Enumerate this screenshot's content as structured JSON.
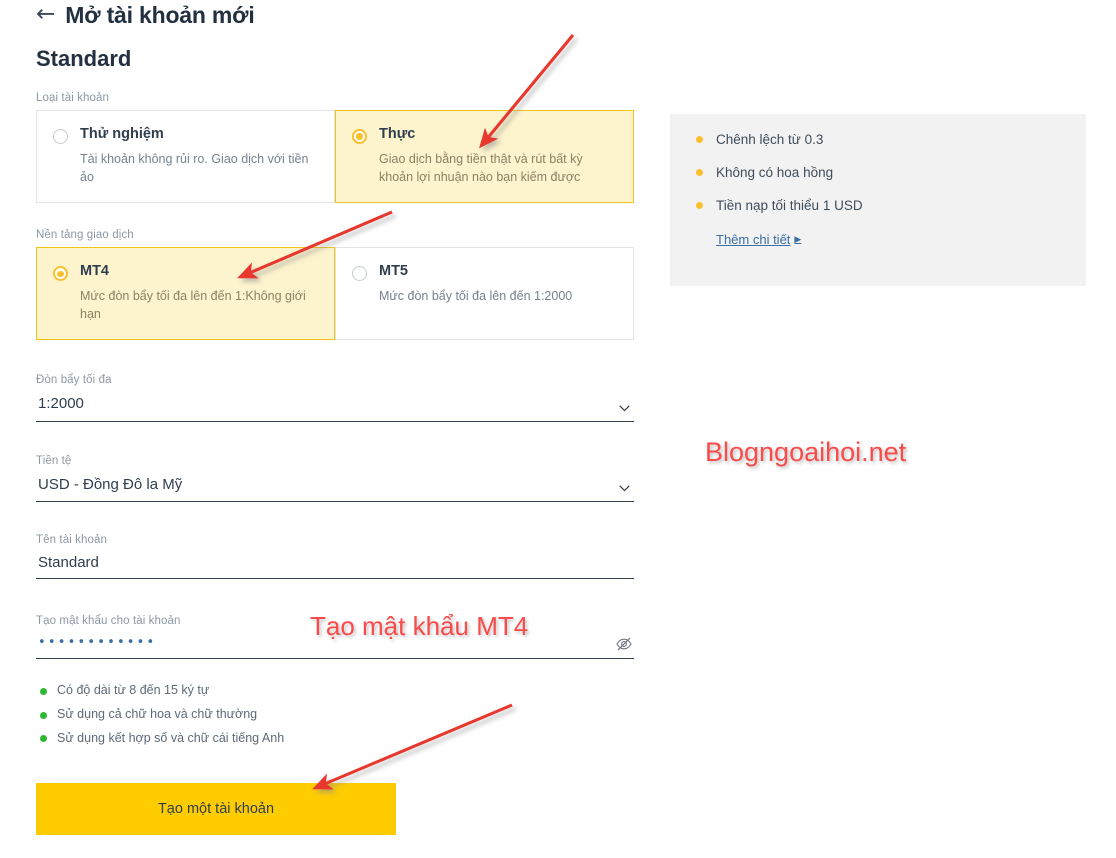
{
  "header": {
    "back_icon": "back-arrow-icon",
    "title": "Mở tài khoản mới",
    "subtitle": "Standard"
  },
  "form": {
    "account_type": {
      "label": "Loại tài khoản",
      "options": [
        {
          "title": "Thử nghiệm",
          "desc": "Tài khoản không rủi ro. Giao dịch với tiền ảo",
          "selected": false
        },
        {
          "title": "Thực",
          "desc": "Giao dịch bằng tiền thật và rút bất kỳ khoản lợi nhuận nào bạn kiếm được",
          "selected": true
        }
      ]
    },
    "platform": {
      "label": "Nền tảng giao dịch",
      "options": [
        {
          "title": "MT4",
          "desc": "Mức đòn bẩy tối đa lên đến 1:Không giới hạn",
          "selected": true
        },
        {
          "title": "MT5",
          "desc": "Mức đòn bẩy tối đa lên đến 1:2000",
          "selected": false
        }
      ]
    },
    "leverage": {
      "label": "Đòn bẩy tối đa",
      "value": "1:2000",
      "icon": "chevron-down-icon"
    },
    "currency": {
      "label": "Tiền tệ",
      "value": "USD - Đồng Đô la Mỹ",
      "icon": "chevron-down-icon"
    },
    "account_name": {
      "label": "Tên tài khoản",
      "value": "Standard"
    },
    "password": {
      "label": "Tạo mật khẩu cho tài khoản",
      "value": "••••••••••••",
      "toggle_icon": "eye-off-icon"
    },
    "requirements": [
      "Có độ dài từ 8 đến 15 ký tự",
      "Sử dụng cả chữ hoa và chữ thường",
      "Sử dụng kết hợp số và chữ cái tiếng Anh"
    ],
    "submit_label": "Tạo một tài khoản"
  },
  "info_panel": {
    "items": [
      "Chênh lệch từ 0.3",
      "Không có hoa hồng",
      "Tiền nạp tối thiểu 1 USD"
    ],
    "more_link": "Thêm chi tiết",
    "more_link_arrow": "▶"
  },
  "annotations": {
    "password_note": "Tạo mật khẩu MT4",
    "watermark": "Blogngoaihoi.net"
  },
  "colors": {
    "accent_yellow": "#ffcc00",
    "selected_card_bg": "#fdf3cd",
    "selected_card_border": "#f0c419",
    "radio_on": "#fbc02d",
    "text_dark": "#2f3e4f",
    "label_gray": "#8c98a4",
    "green_dot": "#2eb82e",
    "annotation_red": "#fa4b4b",
    "panel_bg": "#f2f2f2",
    "link_blue": "#3a6ea5"
  }
}
